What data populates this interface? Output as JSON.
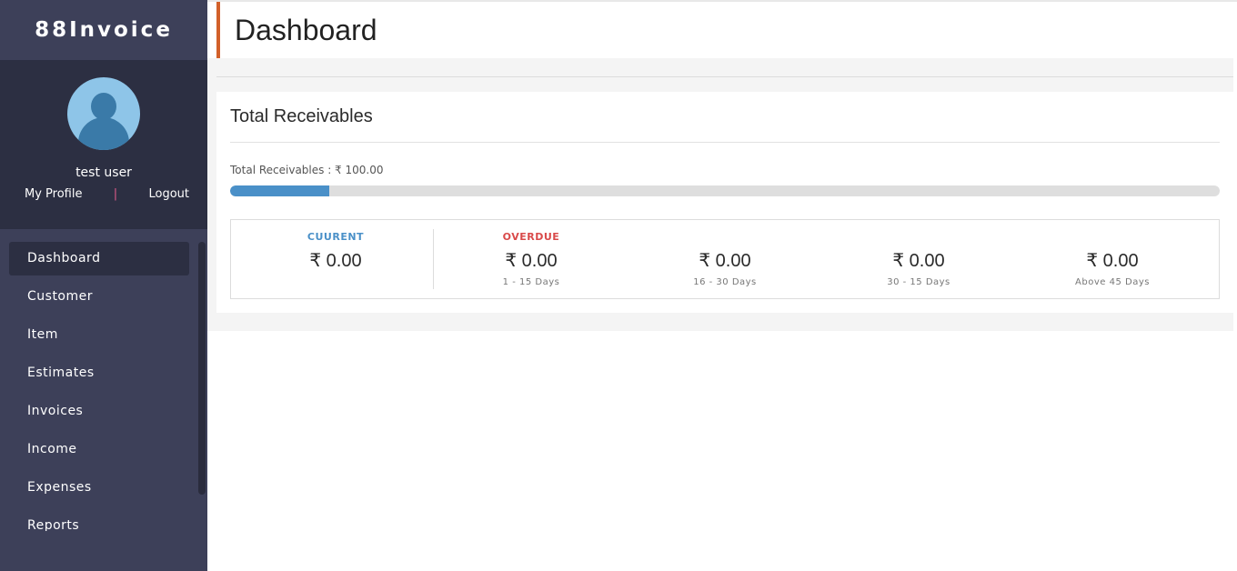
{
  "brand": {
    "name": "88Invoice"
  },
  "user": {
    "name": "test user",
    "profile_link": "My Profile",
    "separator": "|",
    "logout_link": "Logout"
  },
  "menu": {
    "items": [
      {
        "label": "Dashboard"
      },
      {
        "label": "Customer"
      },
      {
        "label": "Item"
      },
      {
        "label": "Estimates"
      },
      {
        "label": "Invoices"
      },
      {
        "label": "Income"
      },
      {
        "label": "Expenses"
      },
      {
        "label": "Reports"
      }
    ],
    "active": "Dashboard"
  },
  "page": {
    "title": "Dashboard"
  },
  "receivables": {
    "title": "Total Receivables",
    "summary_label": "Total Receivables : ₹ 100.00",
    "progress_fraction": 0.1,
    "current": {
      "label": "CUURENT",
      "amount": "₹ 0.00"
    },
    "overdue": {
      "label": "OVERDUE"
    },
    "buckets": [
      {
        "amount": "₹ 0.00",
        "range": "1 - 15 Days"
      },
      {
        "amount": "₹ 0.00",
        "range": "16 - 30 Days"
      },
      {
        "amount": "₹ 0.00",
        "range": "30 - 15 Days"
      },
      {
        "amount": "₹ 0.00",
        "range": "Above 45 Days"
      }
    ]
  },
  "colors": {
    "sidebar": "#3d4059",
    "sidebar_dark": "#2c2f42",
    "accent": "#d2602a",
    "current_label": "#4a90c8",
    "overdue_label": "#d94a4a",
    "progress_fill": "#4a90c8"
  },
  "icons": {
    "avatar": "user-silhouette-icon"
  }
}
